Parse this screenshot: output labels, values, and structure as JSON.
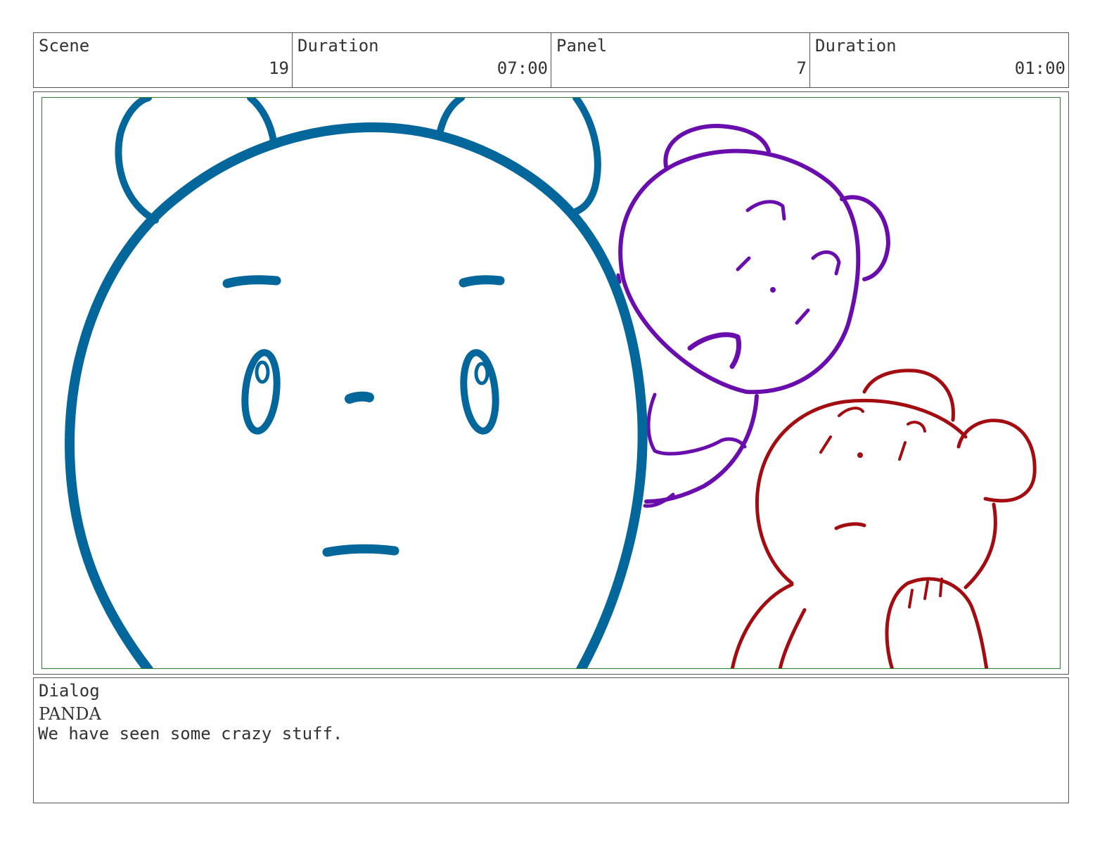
{
  "header": {
    "scene_label": "Scene",
    "scene_value": "19",
    "scene_duration_label": "Duration",
    "scene_duration_value": "07:00",
    "panel_label": "Panel",
    "panel_value": "7",
    "panel_duration_label": "Duration",
    "panel_duration_value": "01:00"
  },
  "artwork": {
    "characters": [
      "blue-bear-closeup",
      "purple-bear",
      "red-bear"
    ],
    "colors": {
      "blue": "#04679b",
      "purple": "#6a0dad",
      "red": "#a30d12",
      "safe_frame": "#2e7d32",
      "border": "#555555"
    }
  },
  "dialog": {
    "label": "Dialog",
    "speaker": "PANDA",
    "line": "We have seen some crazy stuff."
  }
}
